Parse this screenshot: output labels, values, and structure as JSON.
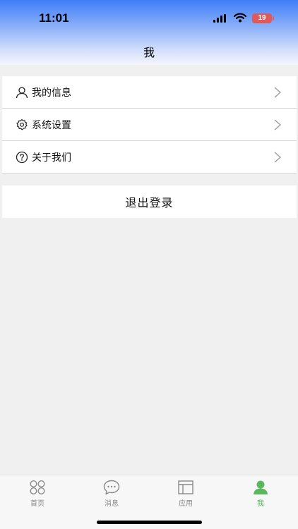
{
  "status_bar": {
    "time": "11:01",
    "battery": "19",
    "battery_color": "#e05a5a"
  },
  "header": {
    "title": "我"
  },
  "menu": {
    "items": [
      {
        "label": "我的信息",
        "icon": "user-icon"
      },
      {
        "label": "系统设置",
        "icon": "gear-icon"
      },
      {
        "label": "关于我们",
        "icon": "question-icon"
      }
    ]
  },
  "logout": {
    "label": "退出登录"
  },
  "tabbar": {
    "active_color": "#4caf50",
    "tabs": [
      {
        "label": "首页",
        "icon": "home-icon",
        "active": false
      },
      {
        "label": "消息",
        "icon": "message-icon",
        "active": false
      },
      {
        "label": "应用",
        "icon": "apps-icon",
        "active": false
      },
      {
        "label": "我",
        "icon": "profile-icon",
        "active": true
      }
    ]
  }
}
